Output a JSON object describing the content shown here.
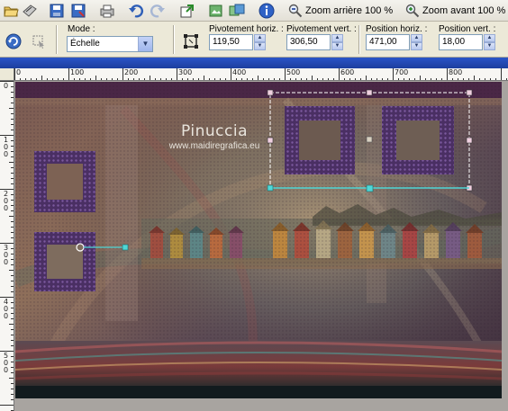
{
  "toolbar": {
    "zoom_out_label": "Zoom arrière 100 %",
    "zoom_in_label": "Zoom avant 100 %"
  },
  "options": {
    "mode_label": "Mode :",
    "mode_value": "Échelle",
    "pivot_h_label": "Pivotement horiz. :",
    "pivot_h_value": "119,50",
    "pivot_v_label": "Pivotement vert. :",
    "pivot_v_value": "306,50",
    "pos_h_label": "Position horiz. :",
    "pos_h_value": "471,00",
    "pos_v_label": "Position vert. :",
    "pos_v_value": "18,00"
  },
  "ruler": {
    "top_labels": [
      "0",
      "100",
      "200",
      "300",
      "400",
      "500",
      "600",
      "700",
      "800"
    ],
    "left_labels": [
      "0",
      "100",
      "200",
      "300",
      "400",
      "500"
    ]
  },
  "canvas": {
    "watermark_title": "Pinuccia",
    "watermark_url": "www.maidiregrafica.eu"
  },
  "colors": {
    "accent": "#2b55c8",
    "selection": "#4fd6d6"
  }
}
